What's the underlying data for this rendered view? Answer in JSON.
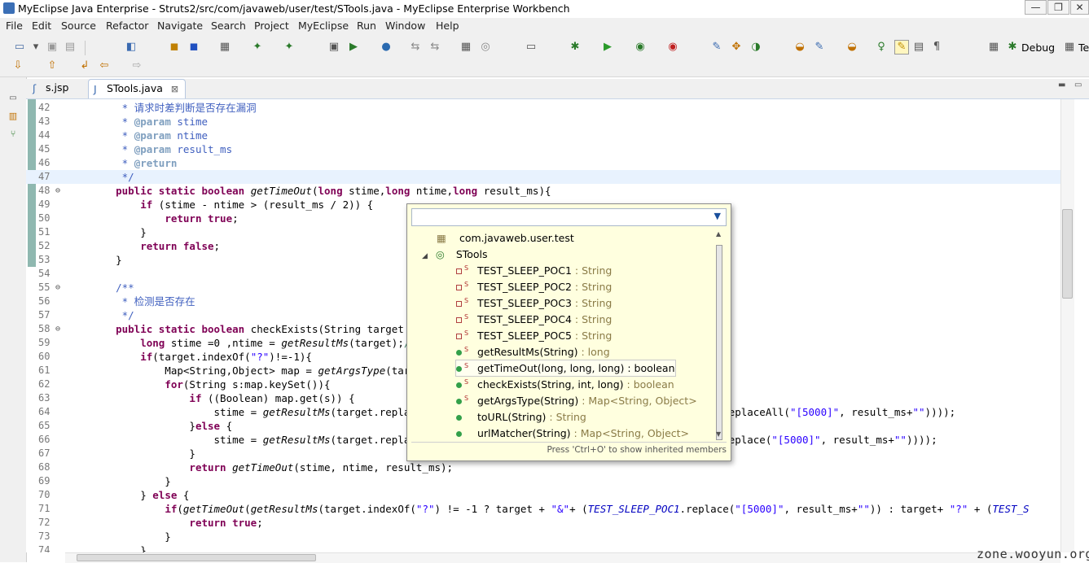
{
  "window": {
    "title": "MyEclipse Java Enterprise - Struts2/src/com/javaweb/user/test/STools.java - MyEclipse Enterprise Workbench",
    "minimize": "—",
    "restore": "❐",
    "close": "✕"
  },
  "menu": [
    "File",
    "Edit",
    "Source",
    "Refactor",
    "Navigate",
    "Search",
    "Project",
    "MyEclipse",
    "Run",
    "Window",
    "Help"
  ],
  "perspective": {
    "debug_label": "Debug",
    "te_label": "Te"
  },
  "tabs": [
    {
      "label": "s.jsp",
      "active": false
    },
    {
      "label": "STools.java",
      "active": true,
      "close": "⊠"
    }
  ],
  "code_lines": [
    {
      "n": "42",
      "fold": "",
      "text": "     * 请求时差判断是否存在漏洞"
    },
    {
      "n": "43",
      "fold": "",
      "text": "     * @param stime"
    },
    {
      "n": "44",
      "fold": "",
      "text": "     * @param ntime"
    },
    {
      "n": "45",
      "fold": "",
      "text": "     * @param result_ms"
    },
    {
      "n": "46",
      "fold": "",
      "text": "     * @return"
    },
    {
      "n": "47",
      "fold": "",
      "text": "     */"
    },
    {
      "n": "48",
      "fold": "⊖",
      "text": "    public static boolean getTimeOut(long stime,long ntime,long result_ms){"
    },
    {
      "n": "49",
      "fold": "",
      "text": "        if (stime - ntime > (result_ms / 2)) {"
    },
    {
      "n": "50",
      "fold": "",
      "text": "            return true;"
    },
    {
      "n": "51",
      "fold": "",
      "text": "        }"
    },
    {
      "n": "52",
      "fold": "",
      "text": "        return false;"
    },
    {
      "n": "53",
      "fold": "",
      "text": "    }"
    },
    {
      "n": "54",
      "fold": "",
      "text": ""
    },
    {
      "n": "55",
      "fold": "⊖",
      "text": "    /**"
    },
    {
      "n": "56",
      "fold": "",
      "text": "     * 检测是否存在"
    },
    {
      "n": "57",
      "fold": "",
      "text": "     */"
    },
    {
      "n": "58",
      "fold": "⊖",
      "text": "    public static boolean checkExists(String target ,"
    },
    {
      "n": "59",
      "fold": "",
      "text": "        long stime =0 ,ntime = getResultMs(target);//"
    },
    {
      "n": "60",
      "fold": "",
      "text": "        if(target.indexOf(\"?\")!=-1){"
    },
    {
      "n": "61",
      "fold": "",
      "text": "            Map<String,Object> map = getArgsType(targ"
    },
    {
      "n": "62",
      "fold": "",
      "text": "            for(String s:map.keySet()){"
    },
    {
      "n": "63",
      "fold": "",
      "text": "                if ((Boolean) map.get(s)) {"
    },
    {
      "n": "64",
      "fold": "",
      "text": "                    stime = getResultMs(target.replac                                          EP_POC2.replaceAll(\"[5000]\", result_ms+\"\"))));"
    },
    {
      "n": "65",
      "fold": "",
      "text": "                }else {"
    },
    {
      "n": "66",
      "fold": "",
      "text": "                    stime = getResultMs(target.replac                                          EP_POC3.replace(\"[5000]\", result_ms+\"\"))));"
    },
    {
      "n": "67",
      "fold": "",
      "text": "                }"
    },
    {
      "n": "68",
      "fold": "",
      "text": "                return getTimeOut(stime, ntime, result_ms);"
    },
    {
      "n": "69",
      "fold": "",
      "text": "            }"
    },
    {
      "n": "70",
      "fold": "",
      "text": "        } else {"
    },
    {
      "n": "71",
      "fold": "",
      "text": "            if(getTimeOut(getResultMs(target.indexOf(\"?\") != -1 ? target + \"&\"+ (TEST_SLEEP_POC1.replace(\"[5000]\", result_ms+\"\")) : target+ \"?\" + (TEST_S"
    },
    {
      "n": "72",
      "fold": "",
      "text": "                return true;"
    },
    {
      "n": "73",
      "fold": "",
      "text": "            }"
    },
    {
      "n": "74",
      "fold": "",
      "text": "        }"
    }
  ],
  "outline": {
    "package": "com.javaweb.user.test",
    "class": "STools",
    "members": [
      {
        "name": "TEST_SLEEP_POC1",
        "type": " : String",
        "kind": "field",
        "static": true
      },
      {
        "name": "TEST_SLEEP_POC2",
        "type": " : String",
        "kind": "field",
        "static": true
      },
      {
        "name": "TEST_SLEEP_POC3",
        "type": " : String",
        "kind": "field",
        "static": true
      },
      {
        "name": "TEST_SLEEP_POC4",
        "type": " : String",
        "kind": "field",
        "static": true
      },
      {
        "name": "TEST_SLEEP_POC5",
        "type": " : String",
        "kind": "field",
        "static": true
      },
      {
        "name": "getResultMs(String)",
        "type": " : long",
        "kind": "method",
        "static": true
      },
      {
        "name": "getTimeOut(long, long, long)",
        "type": " : boolean",
        "kind": "method",
        "static": true,
        "selected": true
      },
      {
        "name": "checkExists(String, int, long)",
        "type": " : boolean",
        "kind": "method",
        "static": true
      },
      {
        "name": "getArgsType(String)",
        "type": " : Map<String, Object>",
        "kind": "method",
        "static": true
      },
      {
        "name": "toURL(String)",
        "type": " : String",
        "kind": "method",
        "static": false
      },
      {
        "name": "urlMatcher(String)",
        "type": " : Map<String, Object>",
        "kind": "method",
        "static": false
      }
    ],
    "hint": "Press 'Ctrl+O' to show inherited members",
    "static_marker": "S"
  },
  "watermark": "zone.wooyun.org",
  "colors": {
    "keyword": "#7f0055",
    "javadoc": "#3f5fbf",
    "javadoc_tag": "#7f9fbf",
    "string": "#2a00ff",
    "comment": "#3f7f5f",
    "static_field": "#0000c0",
    "highlight": "#e8f2fe"
  }
}
